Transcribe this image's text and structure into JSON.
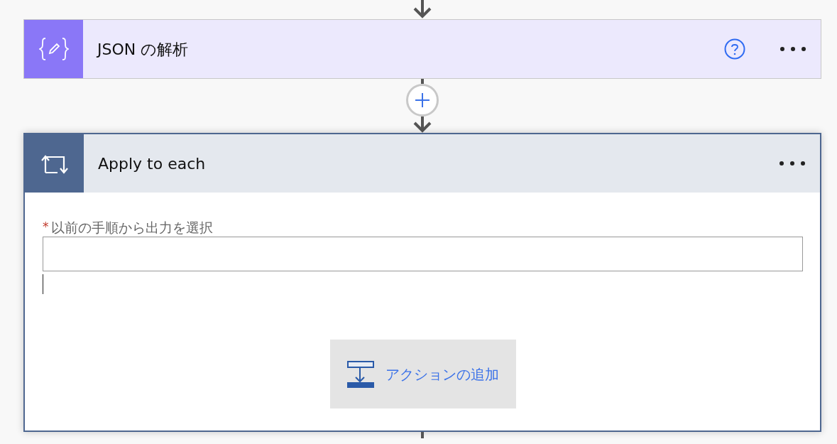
{
  "parse_json_step": {
    "title": "JSON の解析"
  },
  "apply_to_each_step": {
    "title": "Apply to each",
    "field": {
      "required_mark": "*",
      "label": "以前の手順から出力を選択"
    },
    "add_action_button": "アクションの追加"
  }
}
